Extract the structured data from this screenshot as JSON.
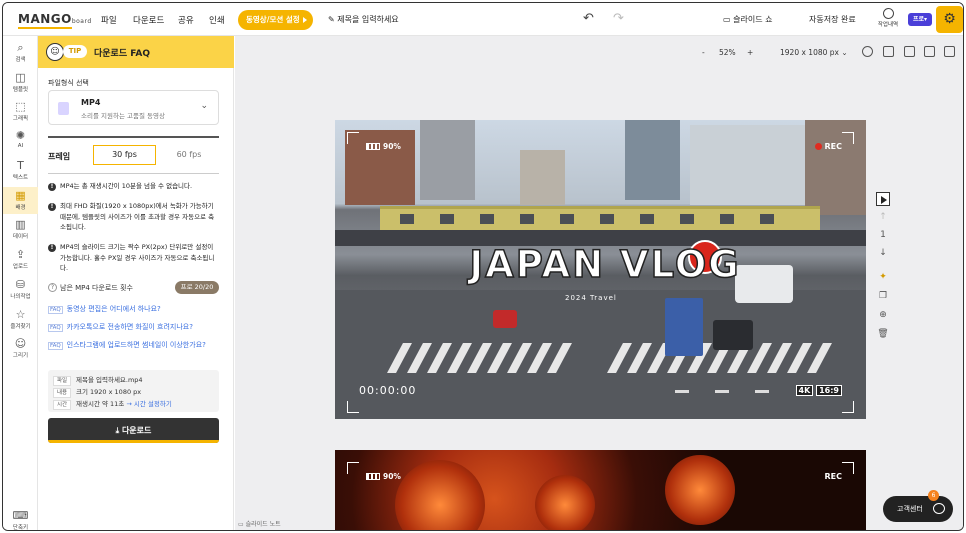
{
  "app": {
    "logo": "MANGO",
    "logo_sub": "board"
  },
  "topbar": {
    "menus": [
      "파일",
      "다운로드",
      "공유",
      "인쇄"
    ],
    "video_setting": "동영상/모션 설정",
    "title_placeholder": "제목을 입력하세요",
    "slideshow": "슬라이드 쇼",
    "autosave": "자동저장 완료",
    "history": "작업내역",
    "pro": "프로"
  },
  "sidebar": {
    "items": [
      {
        "label": "검색",
        "icon": "search-icon"
      },
      {
        "label": "템플릿",
        "icon": "template-icon"
      },
      {
        "label": "그래픽",
        "icon": "graphic-icon"
      },
      {
        "label": "AI",
        "icon": "ai-icon"
      },
      {
        "label": "텍스트",
        "icon": "text-icon"
      },
      {
        "label": "배경",
        "icon": "background-icon"
      },
      {
        "label": "데이터",
        "icon": "chart-icon"
      },
      {
        "label": "업로드",
        "icon": "upload-icon"
      },
      {
        "label": "나의작업",
        "icon": "folder-icon"
      },
      {
        "label": "즐겨찾기",
        "icon": "star-icon"
      },
      {
        "label": "그리기",
        "icon": "draw-icon"
      }
    ],
    "shortcut": "단축키"
  },
  "panel": {
    "tip": "TIP",
    "title": "다운로드 FAQ",
    "format_label": "파일형식 선택",
    "format_name": "MP4",
    "format_desc": "소리를 지원하는 고품질 동영상",
    "frame_label": "프레임",
    "fps_selected": "30 fps",
    "fps_other": "60 fps",
    "notes": [
      "MP4는 총 재생시간이 10분을 넘을 수 없습니다.",
      "최대 FHD 화질(1920 x 1080px)에서 녹화가 가능하기 때문에, 템플릿의 사이즈가 이를 초과할 경우 자동으로 축소됩니다.",
      "MP4의 슬라이드 크기는 짝수 PX(2px) 단위로만 설정이 가능합니다. 홀수 PX일 경우 사이즈가 자동으로 축소됩니다."
    ],
    "remaining_label": "남은 MP4 다운로드 횟수",
    "remaining_value": "프로 20/20",
    "faq_tag": "FAQ",
    "faqs": [
      "동영상 편집은 어디에서 하나요?",
      "카카오톡으로 전송하면 화질이 흐려지나요?",
      "인스타그램에 업로드하면 썸네일이 이상한가요?"
    ],
    "info": {
      "file_key": "파일",
      "file_val": "제목을 입력하세요.mp4",
      "content_key": "내용",
      "content_val": "크기 1920 x 1080 px",
      "time_key": "시간",
      "time_val": "재생시간 약 11초",
      "time_link": "→ 시간 설정하기"
    },
    "download": "다운로드"
  },
  "canvas": {
    "zoom_minus": "-",
    "zoom": "52%",
    "zoom_plus": "+",
    "size": "1920 x 1080 px",
    "slide1": {
      "title": "JAPAN VLOG",
      "subtitle": "2024 Travel",
      "battery": "90%",
      "rec": "REC",
      "timer": "00:00:00",
      "res": "4K",
      "ratio": "16:9"
    },
    "slide2": {
      "battery": "90%",
      "rec": "REC"
    },
    "page_num": "1",
    "notes": "슬라이드 노트",
    "support": "고객센터",
    "support_badge": "6"
  },
  "colors": {
    "accent": "#f5b400",
    "panel_header": "#fbd347",
    "rec": "#e02b20",
    "link": "#3a6fe0"
  }
}
